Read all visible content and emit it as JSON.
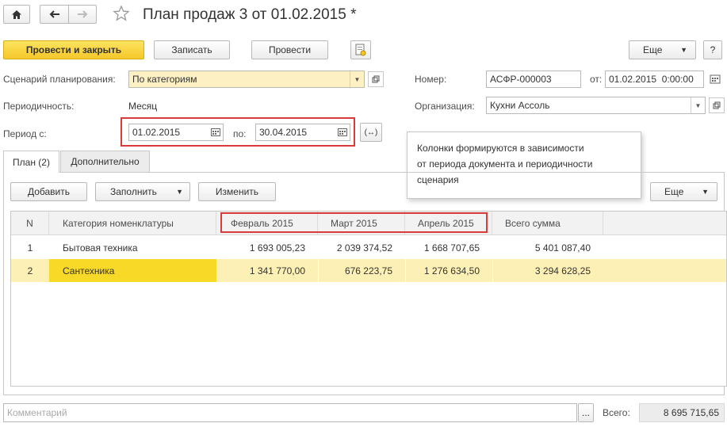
{
  "window": {
    "title": "План продаж 3 от 01.02.2015 *",
    "icons": [
      "home-icon",
      "back-arrow-icon",
      "forward-arrow-icon",
      "star-icon"
    ]
  },
  "toolbar": {
    "post_close": "Провести и закрыть",
    "save": "Записать",
    "post": "Провести",
    "more": "Еще",
    "help": "?"
  },
  "form": {
    "scenario_label": "Сценарий планирования:",
    "scenario_value": "По категориям",
    "number_label": "Номер:",
    "number_value": "АСФР-000003",
    "from_label": "от:",
    "date_value": "01.02.2015  0:00:00",
    "periodicity_label": "Периодичность:",
    "periodicity_value": "Месяц",
    "org_label": "Организация:",
    "org_value": "Кухни Ассоль",
    "period_label": "Период с:",
    "period_from": "01.02.2015",
    "period_to_label": "по:",
    "period_to": "30.04.2015"
  },
  "tooltip": {
    "line1": "Колонки формируются в зависимости",
    "line2": "от периода документа и периодичности",
    "line3": "сценария"
  },
  "tabs": [
    {
      "label": "План (2)",
      "active": true
    },
    {
      "label": "Дополнительно",
      "active": false
    }
  ],
  "table_toolbar": {
    "add": "Добавить",
    "fill": "Заполнить",
    "change": "Изменить",
    "more": "Еще"
  },
  "table": {
    "columns": [
      "N",
      "Категория номенклатуры",
      "Февраль 2015",
      "Март 2015",
      "Апрель 2015",
      "Всего сумма"
    ],
    "rows": [
      {
        "n": "1",
        "category": "Бытовая техника",
        "feb": "1 693 005,23",
        "mar": "2 039 374,52",
        "apr": "1 668 707,65",
        "total": "5 401 087,40",
        "selected": false
      },
      {
        "n": "2",
        "category": "Сантехника",
        "feb": "1 341 770,00",
        "mar": "676 223,75",
        "apr": "1 276 634,50",
        "total": "3 294 628,25",
        "selected": true
      }
    ]
  },
  "footer": {
    "comment_placeholder": "Комментарий",
    "ellipsis": "...",
    "total_label": "Всего:",
    "total_value": "8 695 715,65"
  },
  "colors": {
    "accent_yellow": "#f6c72a",
    "highlight_red": "#d93b3b",
    "selected_row": "#fdf0b4"
  }
}
